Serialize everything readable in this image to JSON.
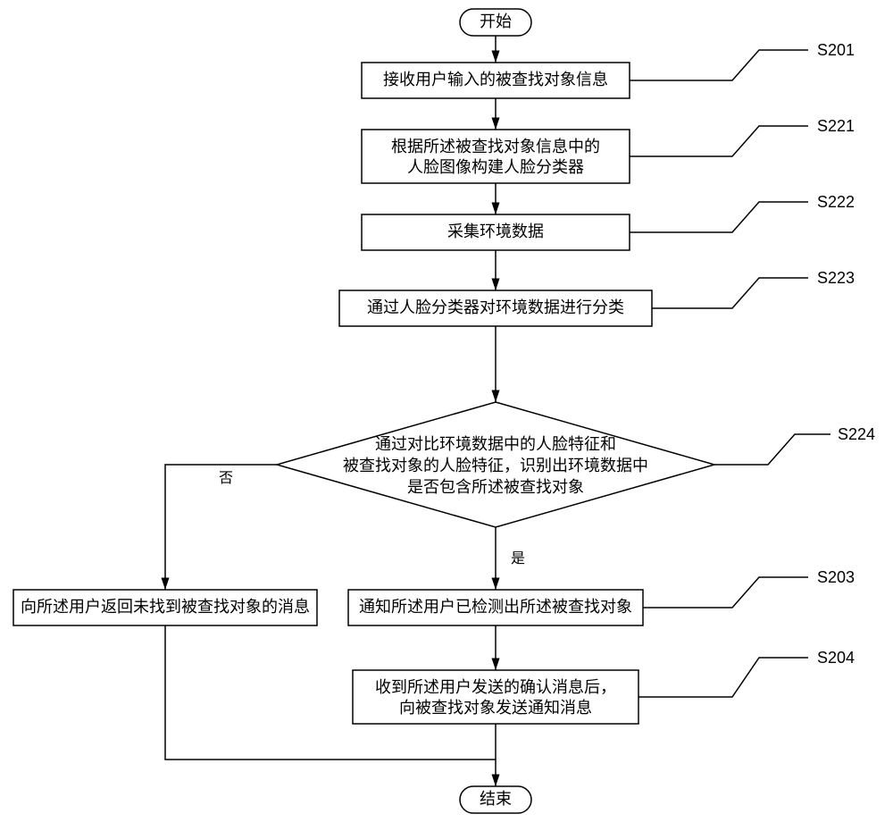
{
  "flow": {
    "start": "开始",
    "end": "结束",
    "steps": {
      "s201": {
        "label": "S201",
        "text": "接收用户输入的被查找对象信息"
      },
      "s221": {
        "label": "S221",
        "text_line1": "根据所述被查找对象信息中的",
        "text_line2": "人脸图像构建人脸分类器"
      },
      "s222": {
        "label": "S222",
        "text": "采集环境数据"
      },
      "s223": {
        "label": "S223",
        "text": "通过人脸分类器对环境数据进行分类"
      },
      "s224": {
        "label": "S224",
        "text_line1": "通过对比环境数据中的人脸特征和",
        "text_line2": "被查找对象的人脸特征，识别出环境数据中",
        "text_line3": "是否包含所述被查找对象"
      },
      "s203": {
        "label": "S203",
        "text": "通知所述用户已检测出所述被查找对象"
      },
      "s204": {
        "label": "S204",
        "text_line1": "收到所述用户发送的确认消息后，",
        "text_line2": "向被查找对象发送通知消息"
      },
      "not_found": {
        "text": "向所述用户返回未找到被查找对象的消息"
      }
    },
    "edges": {
      "yes": "是",
      "no": "否"
    }
  }
}
